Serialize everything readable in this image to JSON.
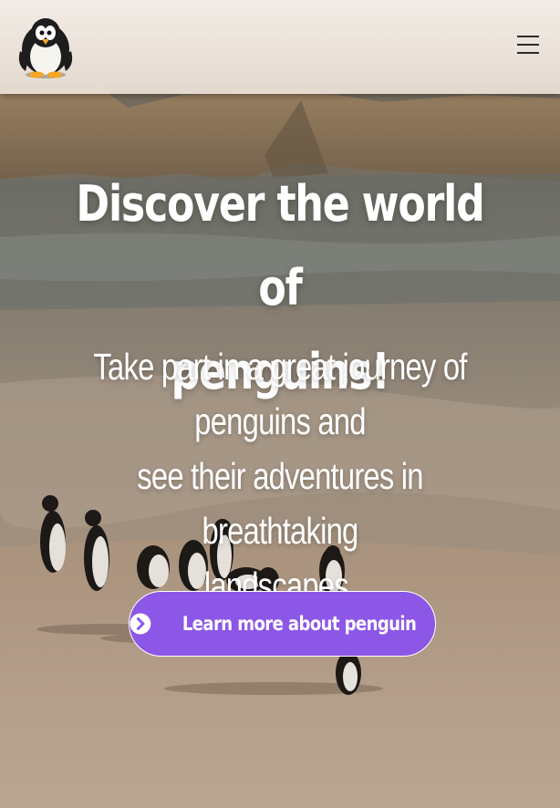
{
  "header": {
    "logo_icon": "penguin-logo-icon",
    "menu_icon": "hamburger-menu-icon"
  },
  "hero": {
    "background": "penguins-walking-on-beach-photo",
    "title_line1": "Discover the world of",
    "title_line2": "penguins!",
    "subtitle_line1": "Take part in a great journey of penguins and",
    "subtitle_line2": "see their adventures in breathtaking",
    "subtitle_line3": "landscapes.",
    "cta_label": "Learn more about penguin",
    "cta_icon": "chevron-right-circle-icon"
  },
  "colors": {
    "cta_bg": "#8c57e6",
    "text": "#ffffff",
    "header_bg": "#f4ece4"
  }
}
